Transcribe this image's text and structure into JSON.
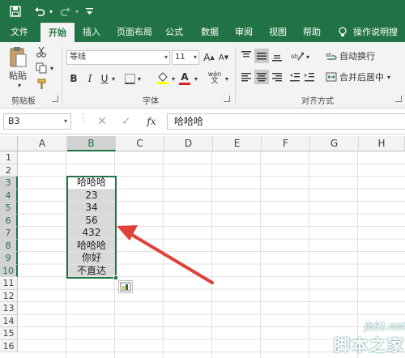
{
  "quick_access": {
    "save": "save-icon",
    "undo": "undo-icon",
    "redo": "redo-icon",
    "customize": "customize-icon"
  },
  "tabs": [
    "文件",
    "开始",
    "插入",
    "页面布局",
    "公式",
    "数据",
    "审阅",
    "视图",
    "帮助",
    "操作说明搜索"
  ],
  "ribbon": {
    "clipboard": {
      "paste_label": "粘贴",
      "group_label": "剪贴板"
    },
    "font": {
      "font_name": "等线",
      "font_size": "11",
      "grow": "A",
      "shrink": "A",
      "bold": "B",
      "italic": "I",
      "underline": "U",
      "fill": "A",
      "phonetic": "wén",
      "group_label": "字体",
      "font_color": "#e02020",
      "fill_color": "#ffff00"
    },
    "alignment": {
      "wrap_text": "自动换行",
      "merge_center": "合并后居中",
      "group_label": "对齐方式"
    }
  },
  "formula_bar": {
    "name_box": "B3",
    "fx_label": "fx",
    "content": "哈哈哈"
  },
  "grid": {
    "columns": [
      "A",
      "B",
      "C",
      "D",
      "E",
      "F",
      "G",
      "H"
    ],
    "rows": [
      "1",
      "2",
      "3",
      "4",
      "5",
      "6",
      "7",
      "8",
      "9",
      "10",
      "11",
      "12",
      "13",
      "14",
      "15",
      "16"
    ],
    "column_b_values": [
      "哈哈哈",
      "23",
      "34",
      "56",
      "432",
      "哈哈哈",
      "你好",
      "不直达"
    ]
  },
  "watermark": {
    "site": "jb51.net",
    "brand": "脚本之家"
  },
  "colors": {
    "accent": "#217346",
    "arrow": "#e0413b"
  }
}
